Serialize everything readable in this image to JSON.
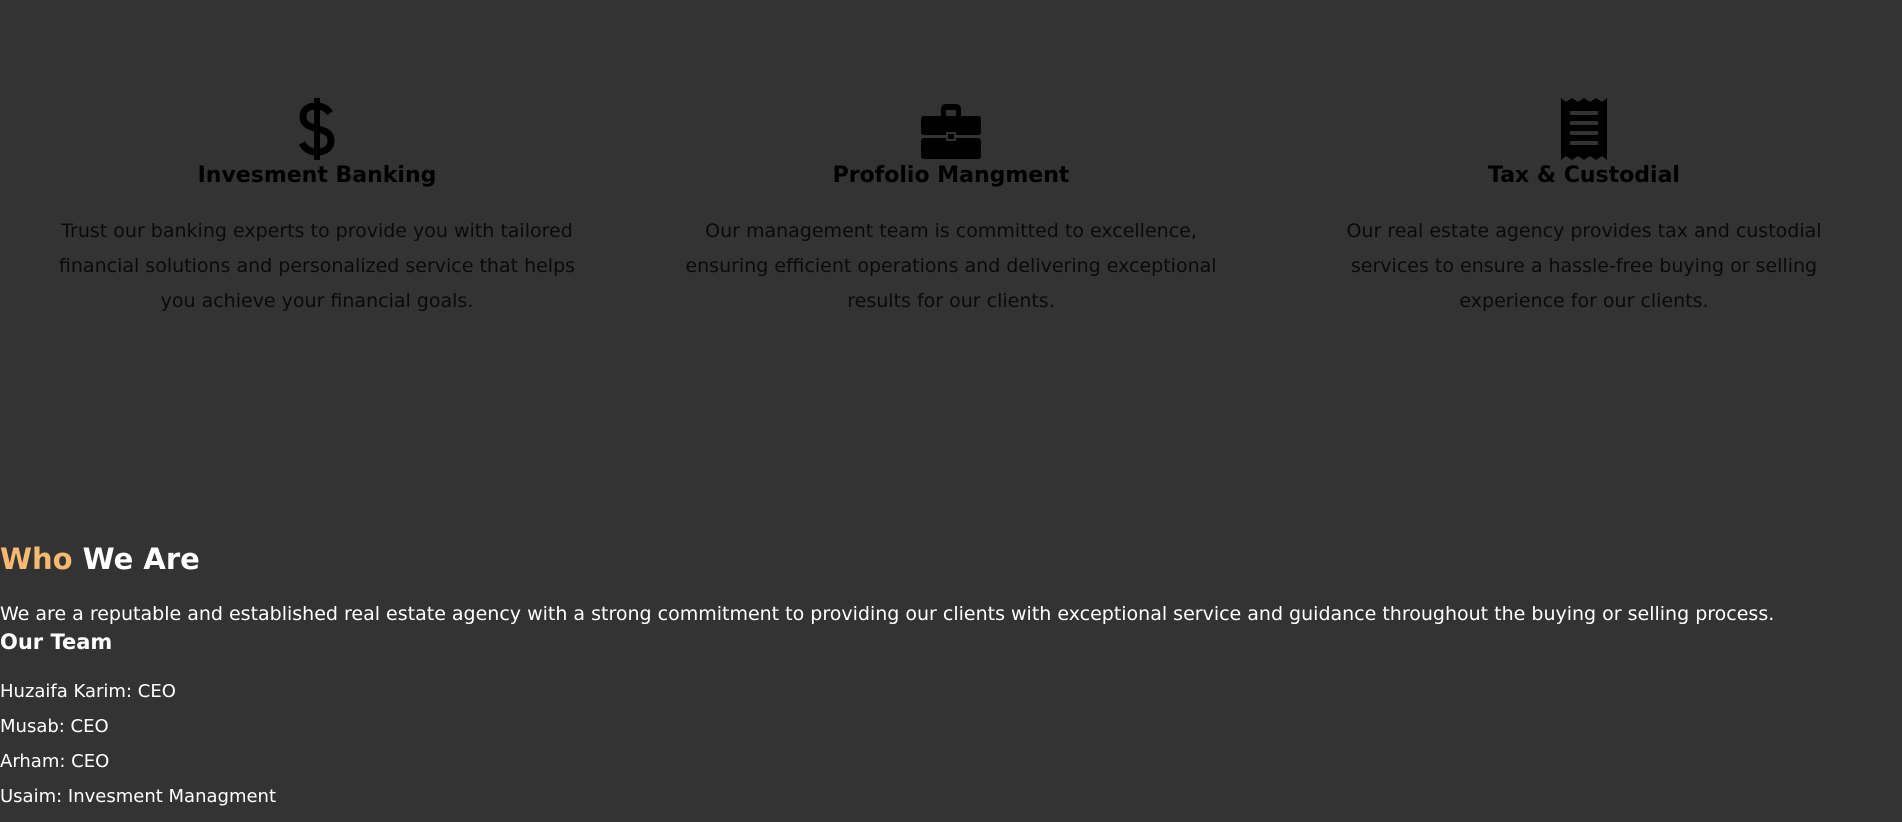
{
  "services": [
    {
      "icon": "dollar-icon",
      "title": "Invesment Banking",
      "description": "Trust our banking experts to provide you with tailored financial solutions and personalized service that helps you achieve your financial goals."
    },
    {
      "icon": "briefcase-icon",
      "title": "Profolio Mangment",
      "description": "Our management team is committed to excellence, ensuring efficient operations and delivering exceptional results for our clients."
    },
    {
      "icon": "receipt-icon",
      "title": "Tax & Custodial",
      "description": "Our real estate agency provides tax and custodial services to ensure a hassle-free buying or selling experience for our clients."
    }
  ],
  "who": {
    "title_accent": "Who",
    "title_rest": " We Are",
    "intro": "We are a reputable and established real estate agency with a strong commitment to providing our clients with exceptional service and guidance throughout the buying or selling process.",
    "team_heading": "Our Team",
    "team": [
      "Huzaifa Karim: CEO",
      "Musab: CEO",
      "Arham: CEO",
      "Usaim: Invesment Managment"
    ]
  },
  "colors": {
    "background": "#333333",
    "accent": "#f5b971",
    "service_text": "#000000",
    "light_text": "#ffffff"
  }
}
